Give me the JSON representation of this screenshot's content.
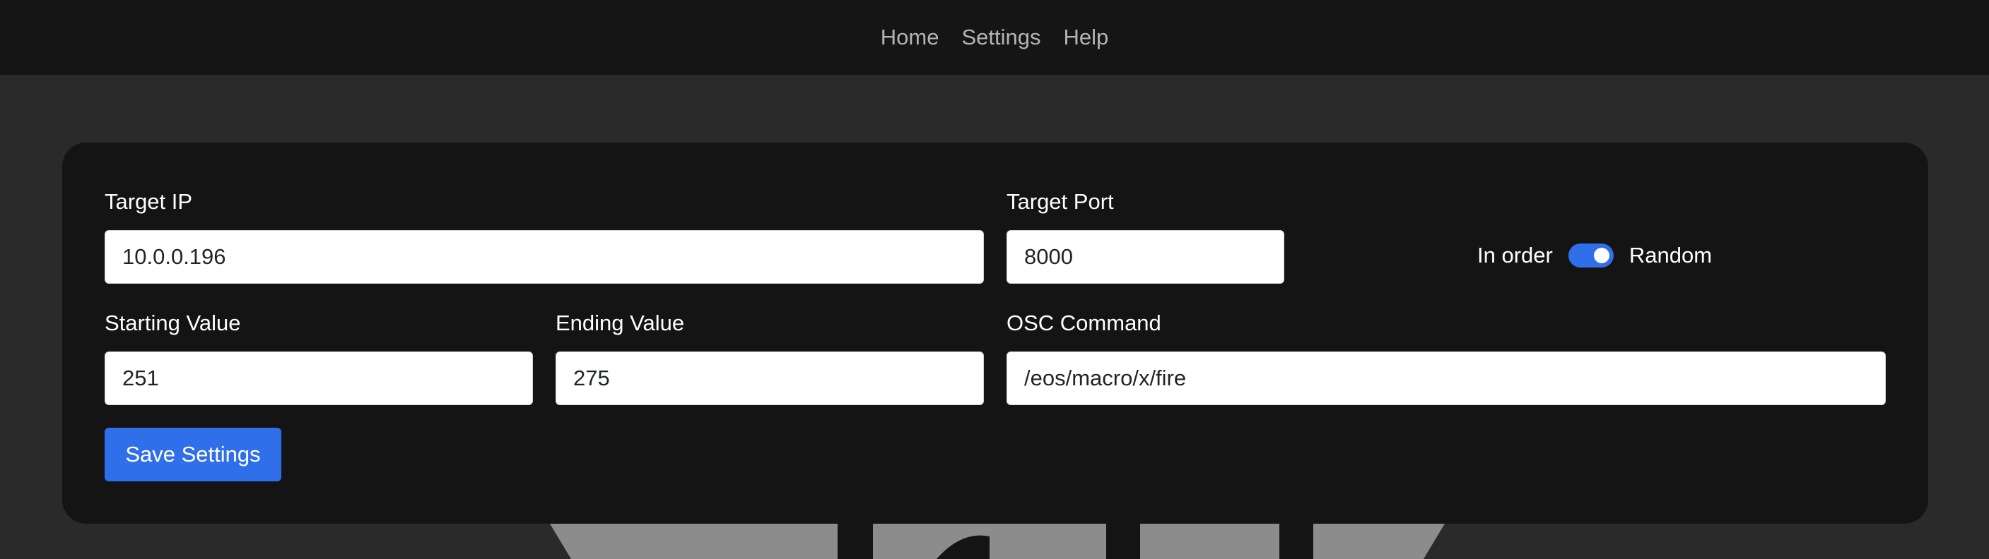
{
  "nav": {
    "items": [
      {
        "label": "Home"
      },
      {
        "label": "Settings"
      },
      {
        "label": "Help"
      }
    ]
  },
  "form": {
    "target_ip": {
      "label": "Target IP",
      "value": "10.0.0.196"
    },
    "target_port": {
      "label": "Target Port",
      "value": "8000"
    },
    "order_toggle": {
      "left_label": "In order",
      "right_label": "Random",
      "selected": "Random"
    },
    "starting_value": {
      "label": "Starting Value",
      "value": "251"
    },
    "ending_value": {
      "label": "Ending Value",
      "value": "275"
    },
    "osc_command": {
      "label": "OSC Command",
      "value": "/eos/macro/x/fire"
    },
    "save_label": "Save Settings"
  },
  "colors": {
    "accent": "#2f6fea",
    "navbar": "#151515",
    "page_background": "#2a2a2a",
    "card_background": "#141414"
  }
}
